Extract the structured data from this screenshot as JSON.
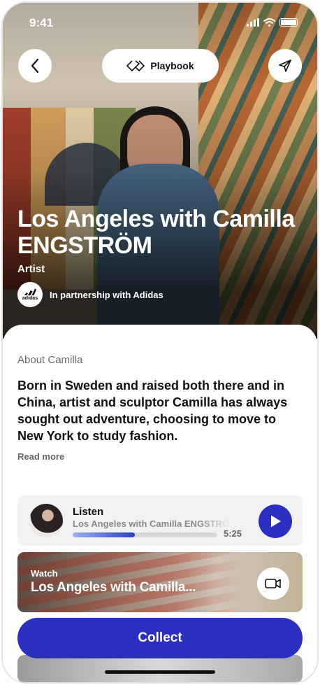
{
  "status_bar": {
    "time": "9:41"
  },
  "header": {
    "playbook_label": "Playbook"
  },
  "hero": {
    "title": "Los Angeles with Camilla ENGSTRÖM",
    "role": "Artist",
    "partner_logo_text": "adidas",
    "partner_text": "In partnership with Adidas"
  },
  "about": {
    "label": "About Camilla",
    "text": "Born in Sweden and raised both there and in China, artist and sculptor Camilla has always sought out adventure, choosing to move to New York to study fashion.",
    "read_more": "Read more"
  },
  "listen": {
    "title": "Listen",
    "subtitle": "Los Angeles with Camilla ENGSTRÖM",
    "duration": "5:25",
    "progress_fraction": 0.43
  },
  "watch": {
    "label": "Watch",
    "title": "Los Angeles with Camilla..."
  },
  "collect": {
    "label": "Collect"
  },
  "colors": {
    "accent": "#2a2fc2",
    "card_bg": "#f2f2f2"
  },
  "icons": {
    "back": "chevron-left-icon",
    "playbook": "diamond-arrows-icon",
    "share": "send-icon",
    "play": "play-icon",
    "video": "video-camera-icon"
  }
}
